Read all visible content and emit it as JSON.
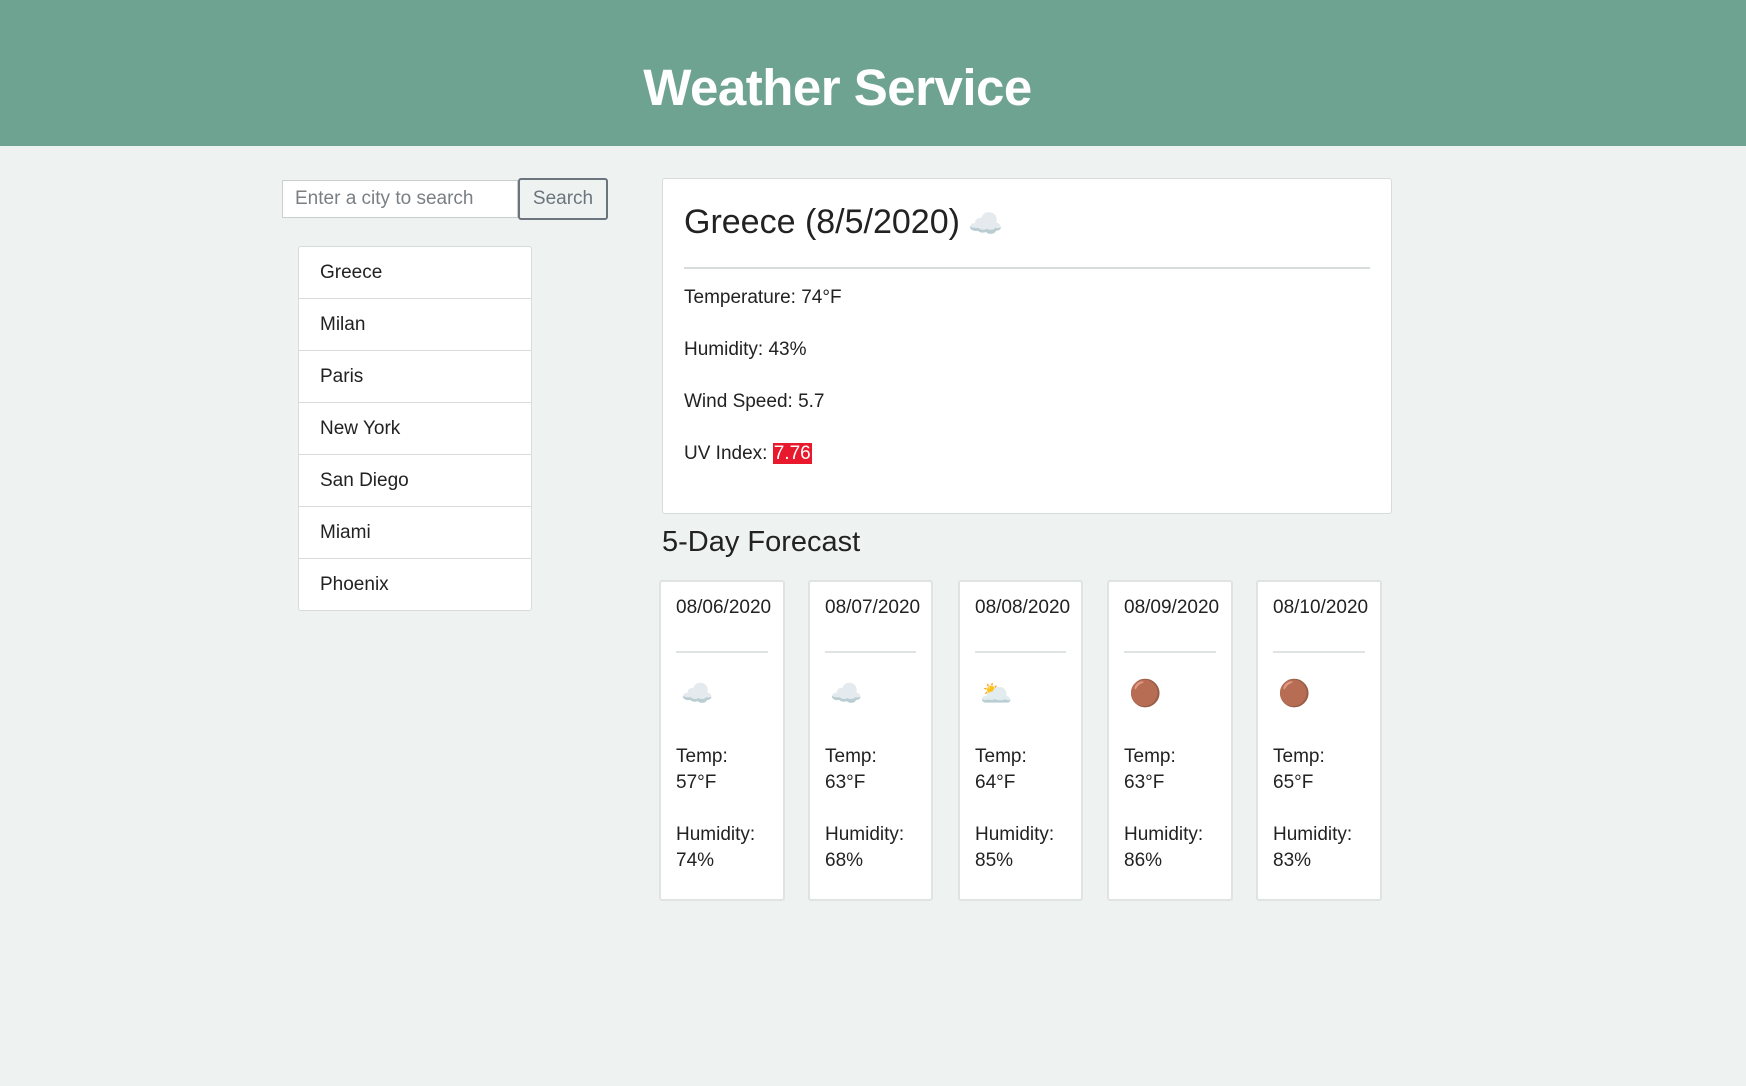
{
  "header": {
    "title": "Weather Service"
  },
  "search": {
    "placeholder": "Enter a city to search",
    "value": "",
    "button_label": "Search"
  },
  "history": {
    "cities": [
      "Greece",
      "Milan",
      "Paris",
      "New York",
      "San Diego",
      "Miami",
      "Phoenix"
    ]
  },
  "current": {
    "title": "Greece (8/5/2020)",
    "icon": "☁️",
    "icon_name": "cloud-icon",
    "temperature": "Temperature: 74°F",
    "humidity": "Humidity: 43%",
    "wind": "Wind Speed: 5.7",
    "uv_label": "UV Index: ",
    "uv_value": "7.76",
    "uv_color": "#e8192c"
  },
  "forecast": {
    "heading": "5-Day Forecast",
    "days": [
      {
        "date": "08/06/2020",
        "icon": "☁️",
        "icon_name": "cloud-icon",
        "temp_label": "Temp:",
        "temp": "57°F",
        "humidity_label": "Humidity:",
        "humidity": "74%"
      },
      {
        "date": "08/07/2020",
        "icon": "☁️",
        "icon_name": "cloud-icon",
        "temp_label": "Temp:",
        "temp": "63°F",
        "humidity_label": "Humidity:",
        "humidity": "68%"
      },
      {
        "date": "08/08/2020",
        "icon": "🌥️",
        "icon_name": "broken-clouds-icon",
        "temp_label": "Temp:",
        "temp": "64°F",
        "humidity_label": "Humidity:",
        "humidity": "85%"
      },
      {
        "date": "08/09/2020",
        "icon": "🟤",
        "icon_name": "rain-icon",
        "temp_label": "Temp:",
        "temp": "63°F",
        "humidity_label": "Humidity:",
        "humidity": "86%"
      },
      {
        "date": "08/10/2020",
        "icon": "🟤",
        "icon_name": "rain-icon",
        "temp_label": "Temp:",
        "temp": "65°F",
        "humidity_label": "Humidity:",
        "humidity": "83%"
      }
    ]
  },
  "colors": {
    "header_bg": "#6fa391",
    "page_bg": "#eef2f1",
    "uv_high": "#e8192c"
  }
}
